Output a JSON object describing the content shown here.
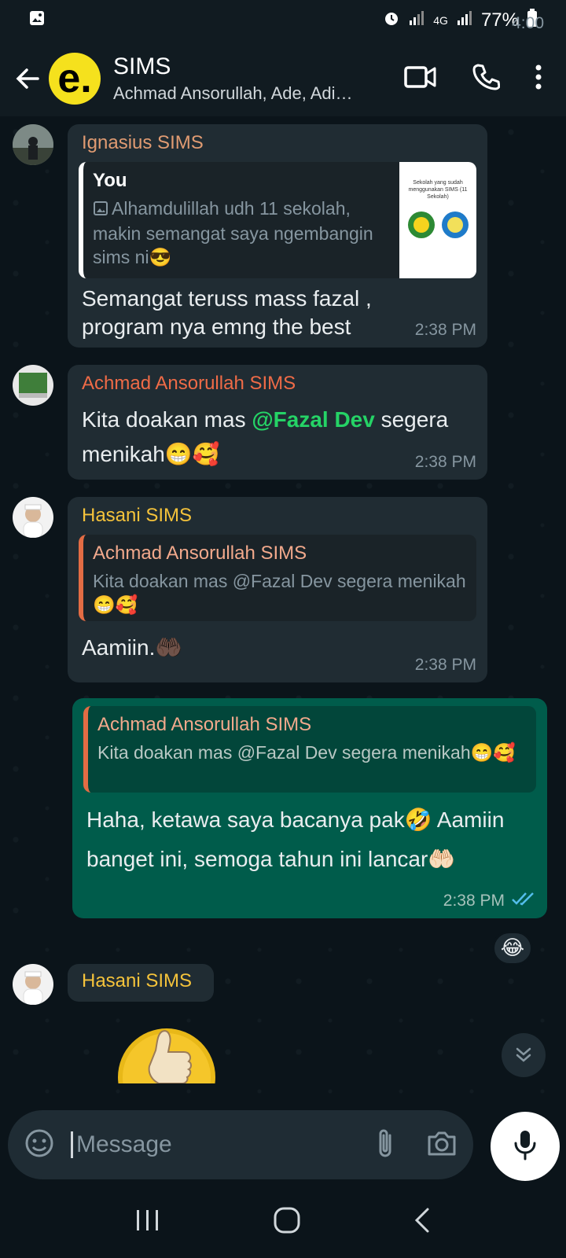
{
  "status_bar": {
    "time": "4:00",
    "network": "4G",
    "battery": "77%"
  },
  "app_bar": {
    "avatar_letter": "e.",
    "title": "SIMS",
    "subtitle": "Achmad Ansorullah, Ade, Adi…",
    "icons": [
      "back-arrow-icon",
      "video-call-icon",
      "voice-call-icon",
      "more-vert-icon"
    ]
  },
  "messages": [
    {
      "sender": "Ignasius SIMS",
      "sender_color": "#e09b72",
      "quote": {
        "name": "You",
        "name_color": "#ffffff",
        "text": "Alhamdulillah udh 11 sekolah, makin semangat saya ngembangin sims ni😎",
        "thumb_caption": "Sekolah yang sudah menggunakan SIMS (11 Sekolah)"
      },
      "text": "Semangat teruss mass fazal , program nya emng the best",
      "time": "2:38 PM"
    },
    {
      "sender": "Achmad Ansorullah SIMS",
      "sender_color": "#ef6b47",
      "text_before": "Kita doakan mas ",
      "mention": "@Fazal Dev",
      "text_after": " segera menikah😁🥰",
      "time": "2:38 PM"
    },
    {
      "sender": "Hasani SIMS",
      "sender_color": "#f5c33b",
      "quote": {
        "name": "Achmad Ansorullah SIMS",
        "name_color": "#f2a98c",
        "text": "Kita doakan mas @Fazal Dev segera menikah😁🥰"
      },
      "text": "Aamiin.🤲🏿",
      "time": "2:38 PM"
    },
    {
      "outgoing": true,
      "quote": {
        "name": "Achmad Ansorullah SIMS",
        "name_color": "#f2a98c",
        "text": "Kita doakan mas @Fazal Dev segera menikah😁🥰"
      },
      "text": "Haha, ketawa saya bacanya pak🤣 Aamiin banget ini, semoga tahun ini lancar🤲🏻",
      "time": "2:38 PM",
      "reaction": "😂"
    },
    {
      "sender": "Hasani SIMS",
      "sender_color": "#f5c33b",
      "sticker": "👍"
    }
  ],
  "composer": {
    "placeholder": "Message",
    "icons": [
      "emoji-sticker-icon",
      "attach-icon",
      "camera-icon",
      "mic-icon"
    ]
  }
}
